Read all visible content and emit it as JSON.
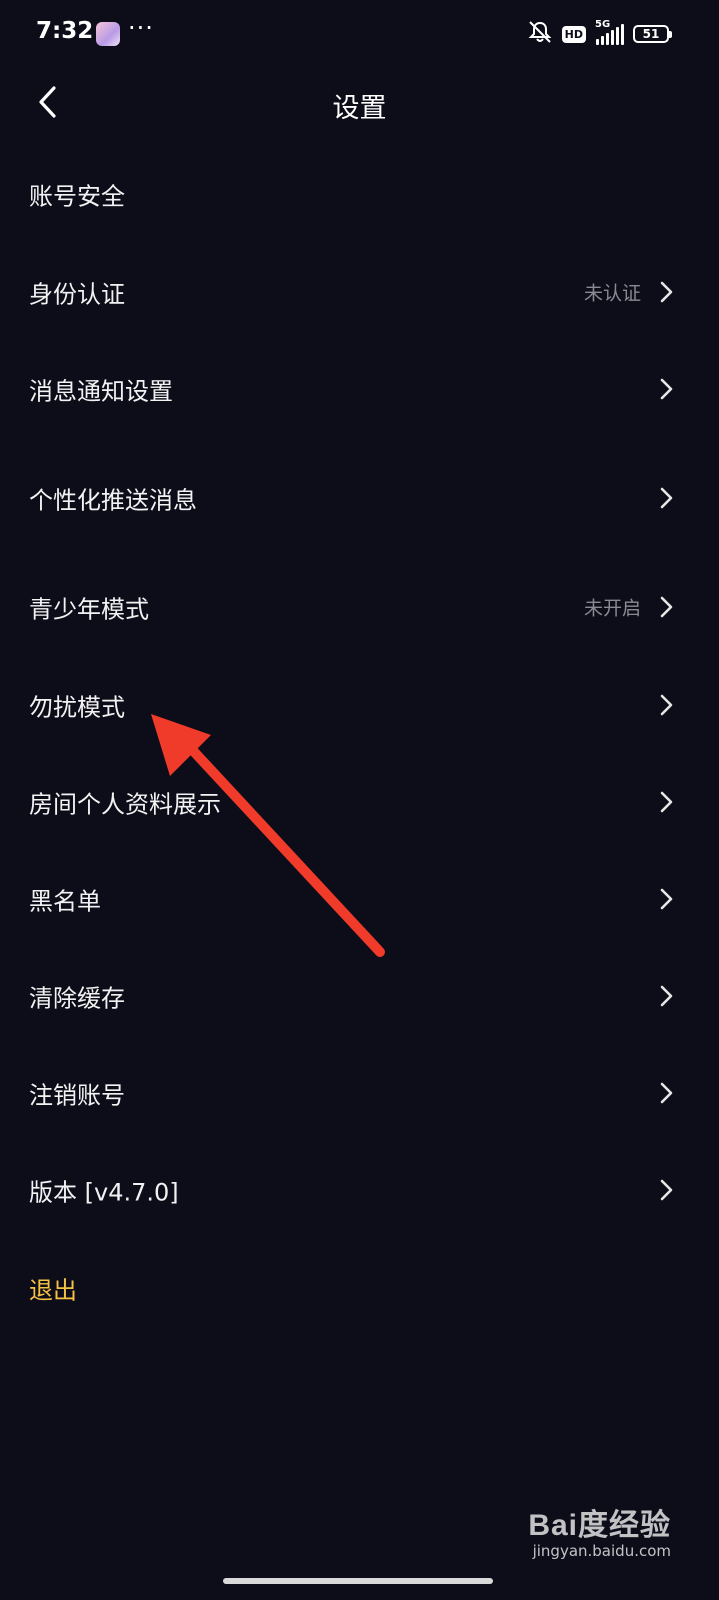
{
  "status_bar": {
    "time": "7:32",
    "dots": "···",
    "app_icon": "app-avatar-icon",
    "mute_icon": "bell-muted-icon",
    "hd_label": "HD",
    "network_label": "5G",
    "battery_level": "51"
  },
  "header": {
    "title": "设置",
    "back_icon": "chevron-left-icon"
  },
  "menu_items": [
    {
      "label": "账号安全",
      "status": "",
      "chevron": false
    },
    {
      "label": "身份认证",
      "status": "未认证",
      "chevron": true
    },
    {
      "label": "消息通知设置",
      "status": "",
      "chevron": true
    },
    {
      "label": "个性化推送消息",
      "status": "",
      "chevron": true
    },
    {
      "label": "青少年模式",
      "status": "未开启",
      "chevron": true
    },
    {
      "label": "勿扰模式",
      "status": "",
      "chevron": true
    },
    {
      "label": "房间个人资料展示",
      "status": "",
      "chevron": true
    },
    {
      "label": "黑名单",
      "status": "",
      "chevron": true
    },
    {
      "label": "清除缓存",
      "status": "",
      "chevron": true
    },
    {
      "label": "注销账号",
      "status": "",
      "chevron": true
    },
    {
      "label": "版本 [v4.7.0]",
      "status": "",
      "chevron": true
    }
  ],
  "logout": {
    "label": "退出",
    "color": "#f5c242"
  },
  "annotation": {
    "arrow_color": "#f03a2a"
  },
  "watermark": {
    "brand": "Bai度经验",
    "url": "jingyan.baidu.com"
  },
  "colors": {
    "background": "#0d0d1a",
    "text": "#f2f2f2",
    "muted": "#8a8a93"
  }
}
